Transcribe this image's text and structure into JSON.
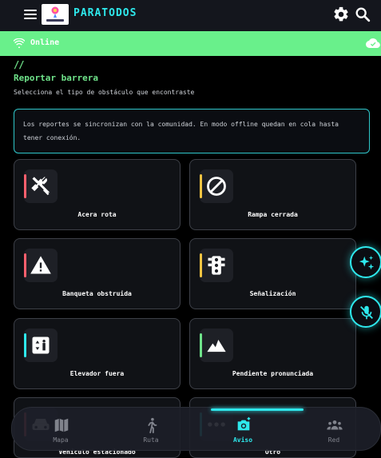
{
  "app": {
    "title": "PARATODOS",
    "logo_name": "paratodos-logo"
  },
  "status": {
    "text": "Online"
  },
  "section": {
    "marker": "//",
    "title": "Reportar barrera",
    "subtitle": "Selecciona el tipo de obstáculo que encontraste"
  },
  "info": {
    "text": "Los reportes se sincronizan con la comunidad. En modo offline quedan en cola hasta tener conexión."
  },
  "obstacles": [
    {
      "label": "Acera rota",
      "icon": "tools-icon",
      "accent": "#ff5f6d"
    },
    {
      "label": "Rampa cerrada",
      "icon": "block-icon",
      "accent": "#f5c542"
    },
    {
      "label": "Banqueta obstruida",
      "icon": "warning-icon",
      "accent": "#ff5f6d"
    },
    {
      "label": "Señalización",
      "icon": "traffic-light-icon",
      "accent": "#f5c542"
    },
    {
      "label": "Elevador fuera",
      "icon": "elevator-icon",
      "accent": "#2ee8ec"
    },
    {
      "label": "Pendiente pronunciada",
      "icon": "terrain-icon",
      "accent": "#6fe38a"
    },
    {
      "label": "Vehículo estacionado",
      "icon": "car-icon",
      "accent": "#ff5f6d"
    },
    {
      "label": "Otro",
      "icon": "more-icon",
      "accent": "#2ee8ec"
    }
  ],
  "nav": [
    {
      "label": "Mapa",
      "icon": "map-icon",
      "active": false
    },
    {
      "label": "Ruta",
      "icon": "walk-icon",
      "active": false
    },
    {
      "label": "Aviso",
      "icon": "camera-icon",
      "active": true
    },
    {
      "label": "Red",
      "icon": "group-icon",
      "active": false
    }
  ],
  "colors": {
    "accent": "#2ee8ec",
    "online": "#69f08b",
    "title": "#6fe38a"
  }
}
